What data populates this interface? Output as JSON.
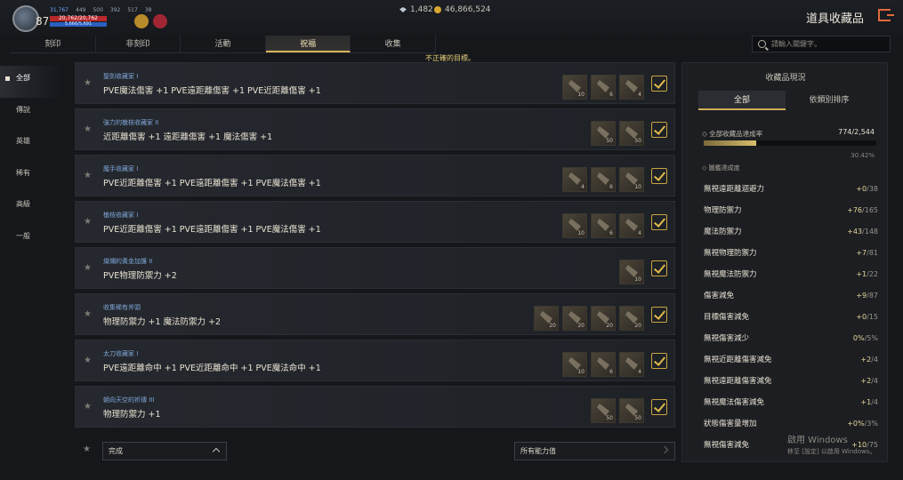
{
  "header": {
    "level": "87",
    "stats": [
      "31,767",
      "449",
      "500",
      "392",
      "517",
      "38"
    ],
    "hp": "20,762/20,762",
    "mp": "5,666/5,691",
    "currency_gem": "1,482",
    "currency_gold": "46,866,524",
    "title": "道具收藏品"
  },
  "tabs": [
    "刻印",
    "非刻印",
    "活動",
    "祝福",
    "收集"
  ],
  "search": {
    "placeholder": "請輸入關鍵字。"
  },
  "warning": "不正確的目標。",
  "sidebar": [
    "全部",
    "傳說",
    "英雄",
    "稀有",
    "高級",
    "一般"
  ],
  "collections": [
    {
      "name": "聖劍收藏家 I",
      "effect": "PVE魔法傷害 +1 PVE遠距離傷害 +1 PVE近距離傷害 +1",
      "counts": [
        "10",
        "6",
        "4"
      ]
    },
    {
      "name": "強力的槍枝收藏家 II",
      "effect": "近距離傷害 +1 遠距離傷害 +1 魔法傷害 +1",
      "counts": [
        "50",
        "50"
      ]
    },
    {
      "name": "魔手收藏家 I",
      "effect": "PVE近距離傷害 +1 PVE遠距離傷害 +1 PVE魔法傷害 +1",
      "counts": [
        "4",
        "6",
        "10"
      ]
    },
    {
      "name": "槍枝收藏家 I",
      "effect": "PVE近距離傷害 +1 PVE遠距離傷害 +1 PVE魔法傷害 +1",
      "counts": [
        "10",
        "6",
        "4"
      ]
    },
    {
      "name": "燦爛的黃金加護 II",
      "effect": "PVE物理防禦力 +2",
      "counts": [
        "10"
      ]
    },
    {
      "name": "收集稀有斧頭",
      "effect": "物理防禦力 +1 魔法防禦力 +2",
      "counts": [
        "20",
        "20",
        "20",
        "20"
      ]
    },
    {
      "name": "太刀收藏家 I",
      "effect": "PVE遠距離命中 +1 PVE近距離命中 +1 PVE魔法命中 +1",
      "counts": [
        "10",
        "6",
        "4"
      ]
    },
    {
      "name": "朝向天空的祈禱 III",
      "effect": "物理防禦力 +1",
      "counts": [
        "50",
        "50"
      ]
    }
  ],
  "bottom": {
    "filter": "完成",
    "ability": "所有能力值"
  },
  "panel": {
    "title": "收藏品現況",
    "tabs": [
      "全部",
      "依類別排序"
    ],
    "progress_label": "全部收藏品達成率",
    "progress_current": "774",
    "progress_total": "/2,544",
    "progress_pct": "30.42%",
    "progress_fraction": 0.3042,
    "section_label": "圖鑑達成度",
    "stats": [
      {
        "label": "無視遠距離迴避力",
        "cur": "+0",
        "max": "/38"
      },
      {
        "label": "物理防禦力",
        "cur": "+76",
        "max": "/165"
      },
      {
        "label": "魔法防禦力",
        "cur": "+43",
        "max": "/148"
      },
      {
        "label": "無視物理防禦力",
        "cur": "+7",
        "max": "/81"
      },
      {
        "label": "無視魔法防禦力",
        "cur": "+1",
        "max": "/22"
      },
      {
        "label": "傷害減免",
        "cur": "+9",
        "max": "/87"
      },
      {
        "label": "目標傷害減免",
        "cur": "+0",
        "max": "/15"
      },
      {
        "label": "無視傷害減少",
        "cur": "0%",
        "max": "/5%"
      },
      {
        "label": "無視近距離傷害減免",
        "cur": "+2",
        "max": "/4"
      },
      {
        "label": "無視遠距離傷害減免",
        "cur": "+2",
        "max": "/4"
      },
      {
        "label": "無視魔法傷害減免",
        "cur": "+1",
        "max": "/4"
      },
      {
        "label": "狀態傷害量增加",
        "cur": "+0%",
        "max": "/3%"
      },
      {
        "label": "無視傷害減免",
        "cur": "+10",
        "max": "/75"
      }
    ]
  },
  "watermark": {
    "line1": "啟用 Windows",
    "line2": "移至 [設定] 以啟用 Windows。"
  }
}
